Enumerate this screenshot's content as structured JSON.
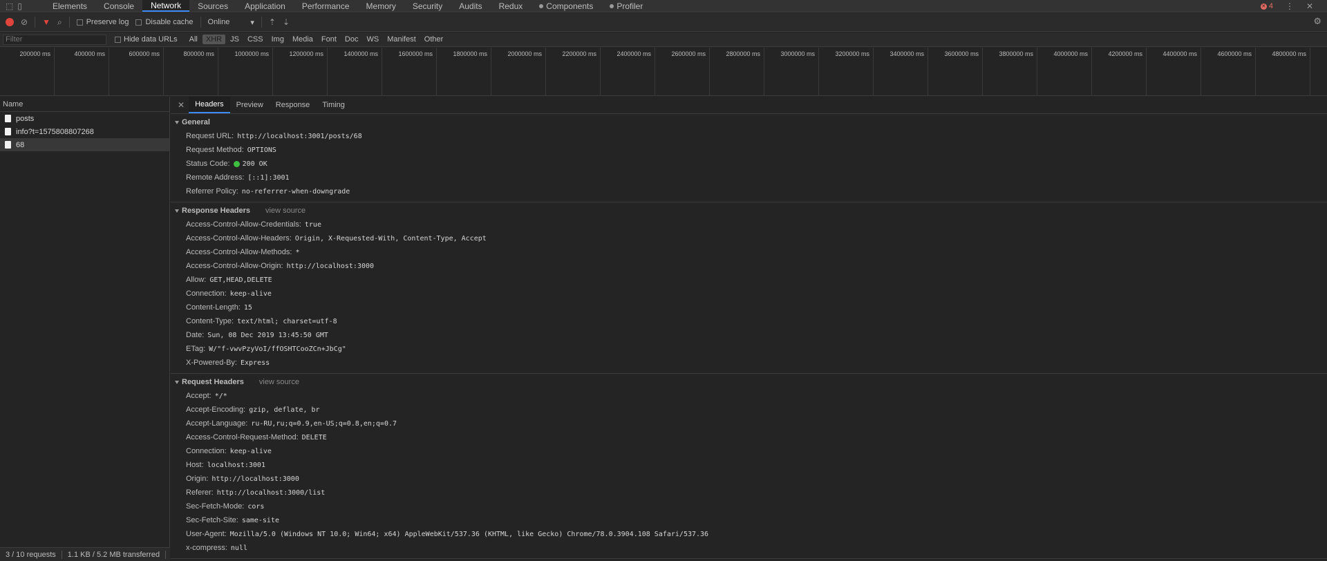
{
  "tabs": [
    {
      "label": "Elements"
    },
    {
      "label": "Console"
    },
    {
      "label": "Network"
    },
    {
      "label": "Sources"
    },
    {
      "label": "Application"
    },
    {
      "label": "Performance"
    },
    {
      "label": "Memory"
    },
    {
      "label": "Security"
    },
    {
      "label": "Audits"
    },
    {
      "label": "Redux"
    },
    {
      "label": "Components"
    },
    {
      "label": "Profiler"
    }
  ],
  "error_count": "4",
  "toolbar": {
    "preserve_log": "Preserve log",
    "disable_cache": "Disable cache",
    "throttling": "Online"
  },
  "filter": {
    "placeholder": "Filter",
    "hide_data_urls": "Hide data URLs",
    "types": [
      "All",
      "XHR",
      "JS",
      "CSS",
      "Img",
      "Media",
      "Font",
      "Doc",
      "WS",
      "Manifest",
      "Other"
    ],
    "active_type": "XHR"
  },
  "timeline": {
    "ticks": [
      "200000 ms",
      "400000 ms",
      "600000 ms",
      "800000 ms",
      "1000000 ms",
      "1200000 ms",
      "1400000 ms",
      "1600000 ms",
      "1800000 ms",
      "2000000 ms",
      "2200000 ms",
      "2400000 ms",
      "2600000 ms",
      "2800000 ms",
      "3000000 ms",
      "3200000 ms",
      "3400000 ms",
      "3600000 ms",
      "3800000 ms",
      "4000000 ms",
      "4200000 ms",
      "4400000 ms",
      "4600000 ms",
      "4800000 ms"
    ]
  },
  "requests": {
    "column": "Name",
    "items": [
      {
        "name": "posts"
      },
      {
        "name": "info?t=1575808807268"
      },
      {
        "name": "68"
      }
    ],
    "summary": "3 / 10 requests",
    "transferred": "1.1 KB / 5.2 MB transferred"
  },
  "detail": {
    "tabs": [
      "Headers",
      "Preview",
      "Response",
      "Timing"
    ],
    "general": {
      "title": "General",
      "request_url": {
        "key": "Request URL:",
        "value": "http://localhost:3001/posts/68"
      },
      "request_method": {
        "key": "Request Method:",
        "value": "OPTIONS"
      },
      "status_code": {
        "key": "Status Code:",
        "value": "200 OK"
      },
      "remote_address": {
        "key": "Remote Address:",
        "value": "[::1]:3001"
      },
      "referrer_policy": {
        "key": "Referrer Policy:",
        "value": "no-referrer-when-downgrade"
      }
    },
    "response_headers": {
      "title": "Response Headers",
      "view_source": "view source",
      "items": [
        {
          "key": "Access-Control-Allow-Credentials:",
          "value": "true"
        },
        {
          "key": "Access-Control-Allow-Headers:",
          "value": "Origin, X-Requested-With, Content-Type, Accept"
        },
        {
          "key": "Access-Control-Allow-Methods:",
          "value": "*"
        },
        {
          "key": "Access-Control-Allow-Origin:",
          "value": "http://localhost:3000"
        },
        {
          "key": "Allow:",
          "value": "GET,HEAD,DELETE"
        },
        {
          "key": "Connection:",
          "value": "keep-alive"
        },
        {
          "key": "Content-Length:",
          "value": "15"
        },
        {
          "key": "Content-Type:",
          "value": "text/html; charset=utf-8"
        },
        {
          "key": "Date:",
          "value": "Sun, 08 Dec 2019 13:45:50 GMT"
        },
        {
          "key": "ETag:",
          "value": "W/\"f-vwvPzyVoI/ffOSHTCooZCn+JbCg\""
        },
        {
          "key": "X-Powered-By:",
          "value": "Express"
        }
      ]
    },
    "request_headers": {
      "title": "Request Headers",
      "view_source": "view source",
      "items": [
        {
          "key": "Accept:",
          "value": "*/*"
        },
        {
          "key": "Accept-Encoding:",
          "value": "gzip, deflate, br"
        },
        {
          "key": "Accept-Language:",
          "value": "ru-RU,ru;q=0.9,en-US;q=0.8,en;q=0.7"
        },
        {
          "key": "Access-Control-Request-Method:",
          "value": "DELETE"
        },
        {
          "key": "Connection:",
          "value": "keep-alive"
        },
        {
          "key": "Host:",
          "value": "localhost:3001"
        },
        {
          "key": "Origin:",
          "value": "http://localhost:3000"
        },
        {
          "key": "Referer:",
          "value": "http://localhost:3000/list"
        },
        {
          "key": "Sec-Fetch-Mode:",
          "value": "cors"
        },
        {
          "key": "Sec-Fetch-Site:",
          "value": "same-site"
        },
        {
          "key": "User-Agent:",
          "value": "Mozilla/5.0 (Windows NT 10.0; Win64; x64) AppleWebKit/537.36 (KHTML, like Gecko) Chrome/78.0.3904.108 Safari/537.36"
        },
        {
          "key": "x-compress:",
          "value": "null"
        }
      ]
    }
  },
  "colors": {
    "background": "#242424",
    "panel": "#2b2b2b",
    "accent": "#3d8aff",
    "record": "#e0453b",
    "status_ok": "#3fbf3f",
    "error": "#e46962"
  }
}
